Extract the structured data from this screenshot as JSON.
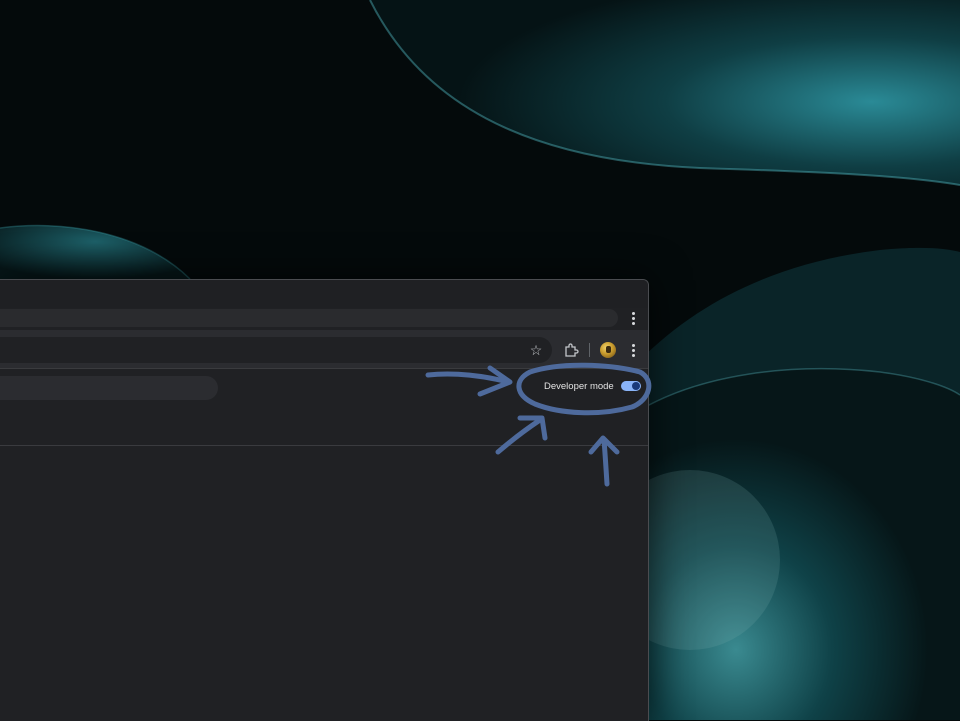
{
  "wallpaper": {
    "colors": [
      "#040a0b",
      "#1f6b76",
      "#0d3a40"
    ]
  },
  "browser": {
    "tab_menu_icon": "vertical-dots-icon",
    "toolbar": {
      "bookmark_icon": "star-icon",
      "extensions_icon": "puzzle-icon",
      "profile_icon": "avatar",
      "menu_icon": "vertical-dots-icon"
    },
    "extensions_page": {
      "developer_mode_label": "Developer mode",
      "developer_mode_enabled": true
    }
  },
  "annotation": {
    "color": "#4e6a9c",
    "shapes": [
      "ellipse-around-toggle",
      "arrow-from-left",
      "arrow-from-bottom-left",
      "arrow-from-below"
    ]
  },
  "colors": {
    "accent": "#8ab4f8",
    "page_bg": "#202124",
    "toolbar_bg": "#2b2c30"
  }
}
